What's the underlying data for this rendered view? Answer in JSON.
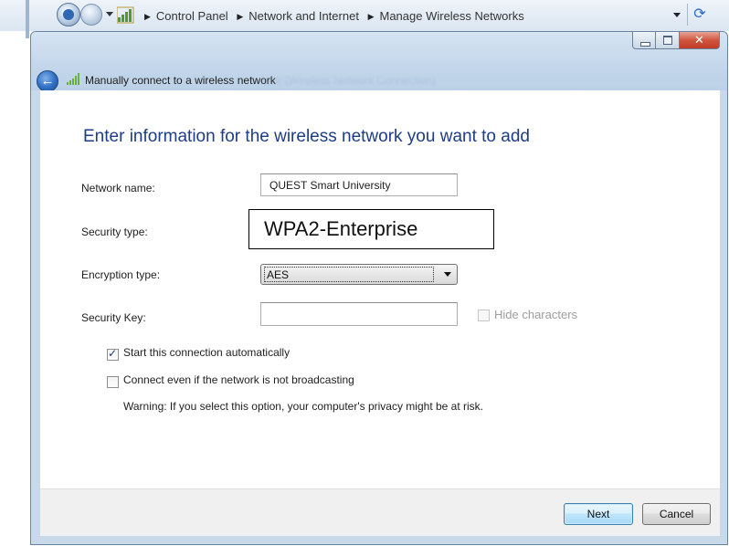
{
  "explorer": {
    "breadcrumb": [
      "Control Panel",
      "Network and Internet",
      "Manage Wireless Networks"
    ]
  },
  "dialog": {
    "title": "Manually connect to a wireless network",
    "title_faded": "Use (Wireless Network Connection)",
    "heading": "Enter information for the wireless network you want to add",
    "fields": {
      "network_name": {
        "label": "Network name:",
        "value": "QUEST Smart University"
      },
      "security_type": {
        "label": "Security type:",
        "value": "WPA2-Enterprise"
      },
      "encryption_type": {
        "label": "Encryption type:",
        "value": "AES"
      },
      "security_key": {
        "label": "Security Key:",
        "value": ""
      }
    },
    "hide_characters": {
      "label": "Hide characters",
      "checked": false,
      "enabled": false
    },
    "start_automatically": {
      "label": "Start this connection automatically",
      "checked": true
    },
    "connect_not_broadcasting": {
      "label": "Connect even if the network is not broadcasting",
      "checked": false
    },
    "warning": "Warning: If you select this option, your computer's privacy might be at risk.",
    "buttons": {
      "next": "Next",
      "cancel": "Cancel"
    }
  },
  "colors": {
    "heading_blue": "#1e3d87",
    "titlebar": "#c3d6ea",
    "close_red": "#c33c25"
  }
}
